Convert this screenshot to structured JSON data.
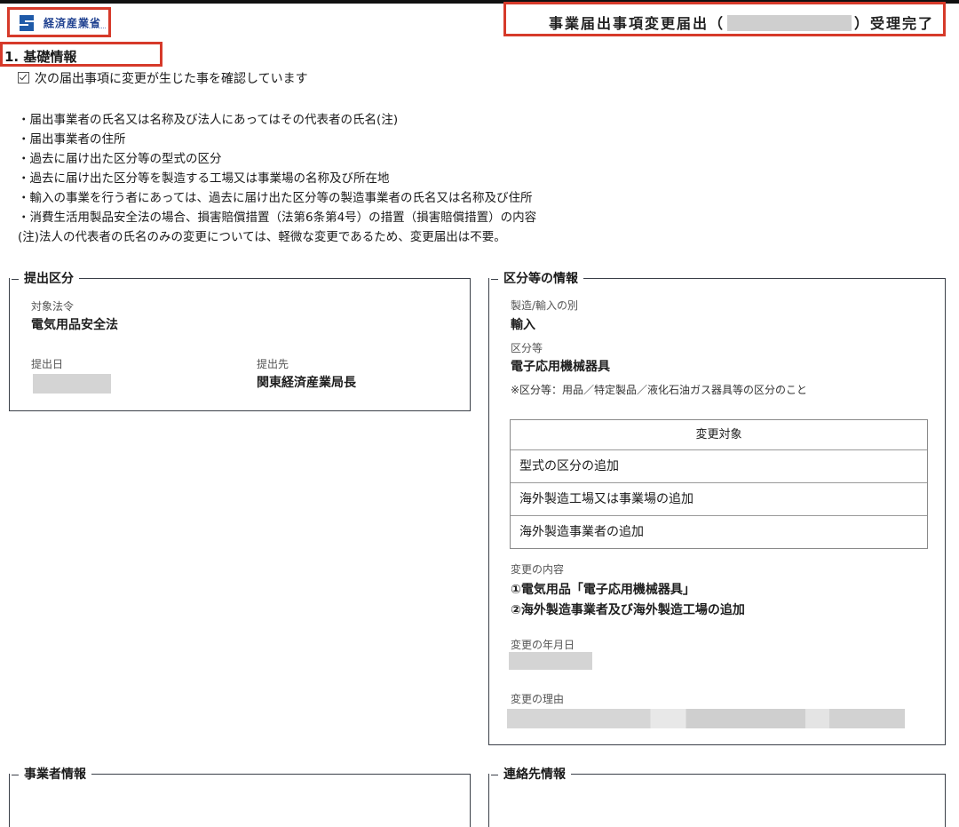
{
  "header": {
    "logo_text": "経済産業省",
    "title_prefix": "事業届出事項変更届出（",
    "title_suffix": "）受理完了"
  },
  "section": {
    "heading": "1. 基礎情報",
    "check_label": "次の届出事項に変更が生じた事を確認しています",
    "notes": [
      "・届出事業者の氏名又は名称及び法人にあってはその代表者の氏名(注)",
      "・届出事業者の住所",
      "・過去に届け出た区分等の型式の区分",
      "・過去に届け出た区分等を製造する工場又は事業場の名称及び所在地",
      "・輸入の事業を行う者にあっては、過去に届け出た区分等の製造事業者の氏名又は名称及び住所",
      "・消費生活用製品安全法の場合、損害賠償措置（法第6条第4号）の措置（損害賠償措置）の内容",
      "(注)法人の代表者の氏名のみの変更については、軽微な変更であるため、変更届出は不要。"
    ]
  },
  "submission": {
    "legend": "提出区分",
    "target_law_label": "対象法令",
    "target_law_value": "電気用品安全法",
    "submit_date_label": "提出日",
    "submit_to_label": "提出先",
    "submit_to_value": "関東経済産業局長"
  },
  "category": {
    "legend": "区分等の情報",
    "mfg_import_label": "製造/輸入の別",
    "mfg_import_value": "輸入",
    "category_label": "区分等",
    "category_value": "電子応用機械器具",
    "category_note": "※区分等：用品／特定製品／液化石油ガス器具等の区分のこと",
    "change_table": {
      "header": "変更対象",
      "rows": [
        "型式の区分の追加",
        "海外製造工場又は事業場の追加",
        "海外製造事業者の追加"
      ]
    },
    "change_content_label": "変更の内容",
    "change_content_lines": [
      "①電気用品「電子応用機械器具」",
      "②海外製造事業者及び海外製造工場の追加"
    ],
    "change_date_label": "変更の年月日",
    "change_reason_label": "変更の理由"
  },
  "bottom": {
    "business_info_legend": "事業者情報",
    "contact_info_legend": "連絡先情報"
  }
}
